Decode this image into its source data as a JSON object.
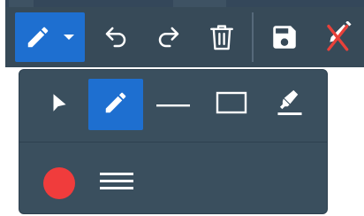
{
  "toolbar": {
    "background": "#374a58",
    "active_background": "#1e6fd0",
    "icon_color": "#ffffff",
    "buttons": [
      {
        "name": "pen-dropdown-button",
        "icon": "pencil-icon",
        "has_caret": true,
        "active": true
      },
      {
        "name": "undo-button",
        "icon": "undo-icon"
      },
      {
        "name": "redo-button",
        "icon": "redo-icon"
      },
      {
        "name": "delete-button",
        "icon": "trash-icon"
      },
      {
        "name": "save-button",
        "icon": "floppy-disk-icon"
      },
      {
        "name": "clear-drawing-button",
        "icon": "pencil-off-icon",
        "accent": "#e8413a"
      }
    ]
  },
  "panel": {
    "background": "#3a4f5e",
    "tools": [
      {
        "name": "select-tool",
        "icon": "cursor-arrow-icon",
        "active": false
      },
      {
        "name": "pen-tool",
        "icon": "pencil-icon",
        "active": true
      },
      {
        "name": "line-tool",
        "icon": "line-icon",
        "active": false
      },
      {
        "name": "rectangle-tool",
        "icon": "rectangle-icon",
        "active": false
      },
      {
        "name": "highlighter-tool",
        "icon": "highlighter-icon",
        "active": false
      }
    ],
    "stroke_color": "#f03c3c",
    "stroke_width_icon": "line-weight-icon"
  }
}
